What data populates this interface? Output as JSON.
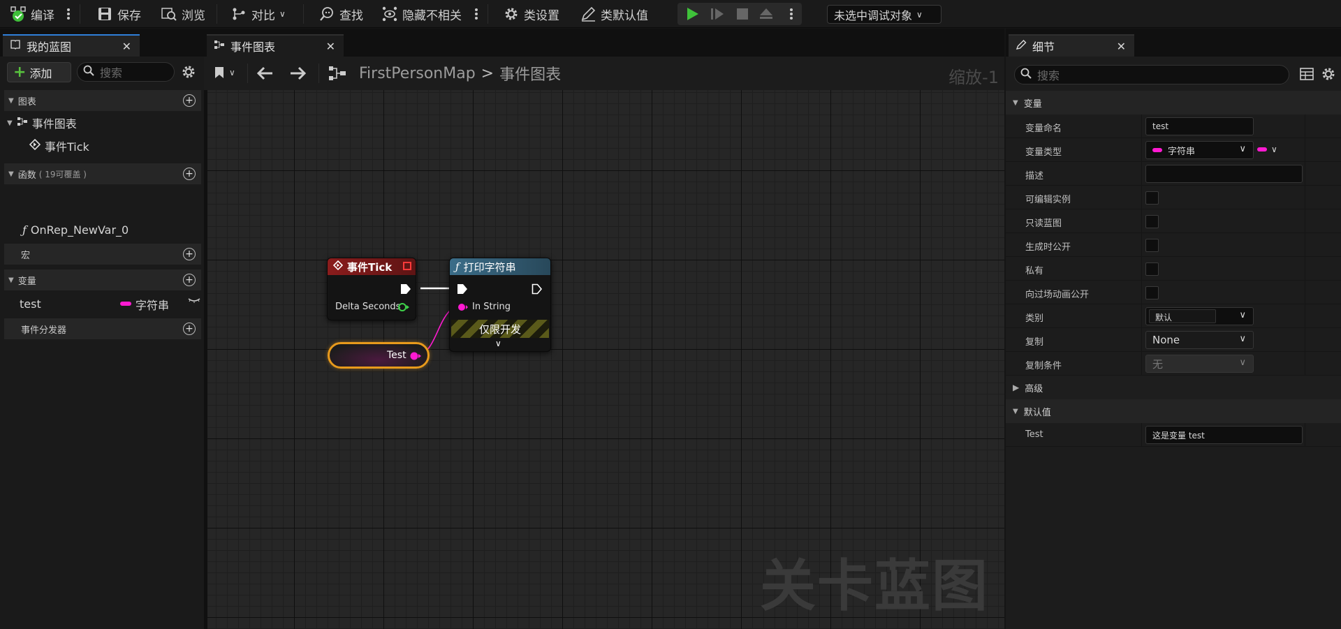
{
  "toolbar": {
    "compile": "编译",
    "save": "保存",
    "browse": "浏览",
    "diff": "对比",
    "find": "查找",
    "hide_unrelated": "隐藏不相关",
    "class_settings": "类设置",
    "class_defaults": "类默认值",
    "debug_target": "未选中调试对象"
  },
  "left_panel": {
    "tab_title": "我的蓝图",
    "add_label": "添加",
    "search_placeholder": "搜索",
    "sections": {
      "graphs": "图表",
      "functions": "函数",
      "functions_note": "( 19可覆盖 )",
      "macros": "宏",
      "variables": "变量",
      "dispatchers": "事件分发器"
    },
    "graph_items": [
      "事件图表",
      "事件Tick"
    ],
    "function_items": [
      "OnRep_NewVar_0"
    ],
    "variable": {
      "name": "test",
      "type": "字符串"
    }
  },
  "graph": {
    "tab_title": "事件图表",
    "breadcrumb": {
      "map": "FirstPersonMap",
      "separator": ">",
      "graph": "事件图表"
    },
    "zoom_label": "缩放-1",
    "watermark": "关卡蓝图",
    "nodes": {
      "event_tick": {
        "title": "事件Tick",
        "pin": "Delta Seconds"
      },
      "print_string": {
        "title": "打印字符串",
        "pin": "In String",
        "dev_only": "仅限开发"
      },
      "getter": {
        "label": "Test"
      }
    }
  },
  "details": {
    "tab_title": "细节",
    "search_placeholder": "搜索",
    "sections": {
      "variable": "变量",
      "advanced": "高级",
      "default_value": "默认值"
    },
    "rows": {
      "name": {
        "label": "变量命名",
        "value": "test"
      },
      "type": {
        "label": "变量类型",
        "value": "字符串"
      },
      "description": {
        "label": "描述",
        "value": ""
      },
      "instance_editable": {
        "label": "可编辑实例"
      },
      "blueprint_readonly": {
        "label": "只读蓝图"
      },
      "expose_on_spawn": {
        "label": "生成时公开"
      },
      "private": {
        "label": "私有"
      },
      "expose_cinematics": {
        "label": "向过场动画公开"
      },
      "category": {
        "label": "类别",
        "value": "默认"
      },
      "replication": {
        "label": "复制",
        "value": "None"
      },
      "replication_condition": {
        "label": "复制条件",
        "value": "无"
      },
      "default_test": {
        "label": "Test",
        "value": "这是变量 test"
      }
    }
  },
  "colors": {
    "string_pin": "#ff1ad1",
    "event_header": "#8a1c1c",
    "function_header": "#3b6d89",
    "float_pin": "#3fd24a",
    "play_green": "#3fc23a"
  }
}
